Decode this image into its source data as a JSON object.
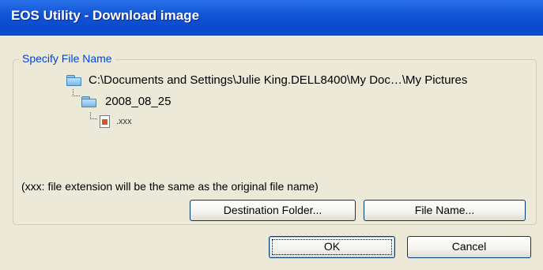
{
  "window": {
    "title": "EOS Utility - Download image"
  },
  "group": {
    "legend": "Specify File Name"
  },
  "tree": {
    "root_path": "C:\\Documents and Settings\\Julie King.DELL8400\\My Doc…\\My Pictures",
    "subfolder": "2008_08_25",
    "file": ".xxx"
  },
  "note": "(xxx: file extension will be the same as the original file name)",
  "buttons": {
    "destination_folder": "Destination Folder...",
    "file_name": "File Name...",
    "ok": "OK",
    "cancel": "Cancel"
  },
  "icons": {
    "folder": "folder-icon",
    "file": "image-file-icon"
  },
  "colors": {
    "titlebar": "#0a48cc",
    "legend_text": "#0046d5",
    "dialog_bg": "#ece9d8"
  }
}
